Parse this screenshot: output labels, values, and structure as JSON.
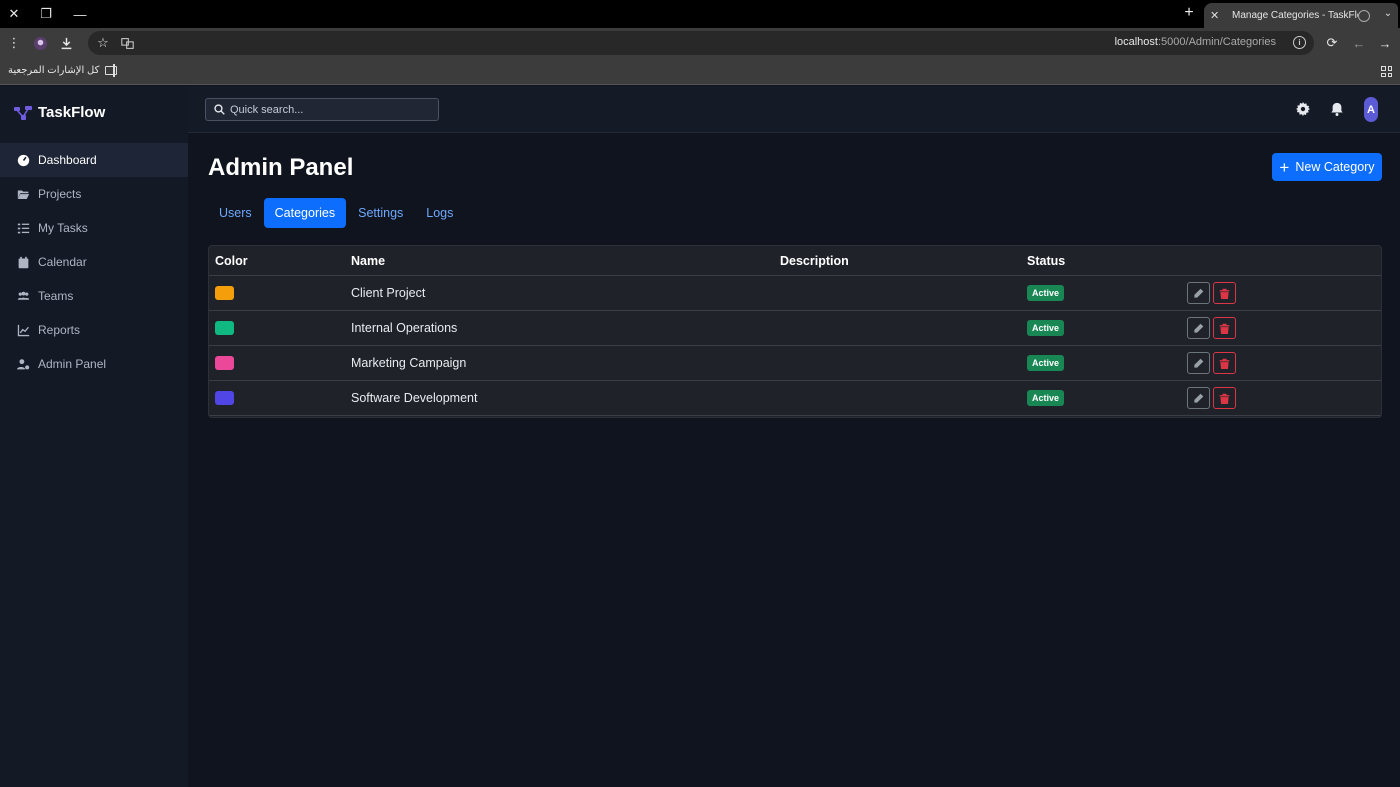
{
  "browser": {
    "tab_title": "Manage Categories - TaskFlow",
    "url_host": "localhost",
    "url_rest": ":5000/Admin/Categories",
    "bookmarks_label": "كل الإشارات المرجعية"
  },
  "app": {
    "brand": "TaskFlow",
    "brand_color": "#6f5ce0",
    "accent": "#0d6efd"
  },
  "sidebar": {
    "items": [
      {
        "label": "Dashboard",
        "icon": "dashboard-gauge-icon",
        "active": true
      },
      {
        "label": "Projects",
        "icon": "folder-open-icon"
      },
      {
        "label": "My Tasks",
        "icon": "tasks-list-icon"
      },
      {
        "label": "Calendar",
        "icon": "calendar-icon"
      },
      {
        "label": "Teams",
        "icon": "users-icon"
      },
      {
        "label": "Reports",
        "icon": "chart-line-icon"
      },
      {
        "label": "Admin Panel",
        "icon": "user-gear-icon"
      }
    ]
  },
  "topbar": {
    "search_placeholder": "Quick search...",
    "avatar_initial": "A"
  },
  "main": {
    "title": "Admin Panel",
    "new_button": "New Category",
    "tabs": [
      {
        "label": "Users"
      },
      {
        "label": "Categories",
        "active": true
      },
      {
        "label": "Settings"
      },
      {
        "label": "Logs"
      }
    ],
    "table": {
      "headers": [
        "Color",
        "Name",
        "Description",
        "Status"
      ],
      "rows": [
        {
          "color": "#f59e0b",
          "name": "Client Project",
          "description": "",
          "status": "Active"
        },
        {
          "color": "#10b981",
          "name": "Internal Operations",
          "description": "",
          "status": "Active"
        },
        {
          "color": "#ec4899",
          "name": "Marketing Campaign",
          "description": "",
          "status": "Active"
        },
        {
          "color": "#4f46e5",
          "name": "Software Development",
          "description": "",
          "status": "Active"
        }
      ]
    }
  }
}
